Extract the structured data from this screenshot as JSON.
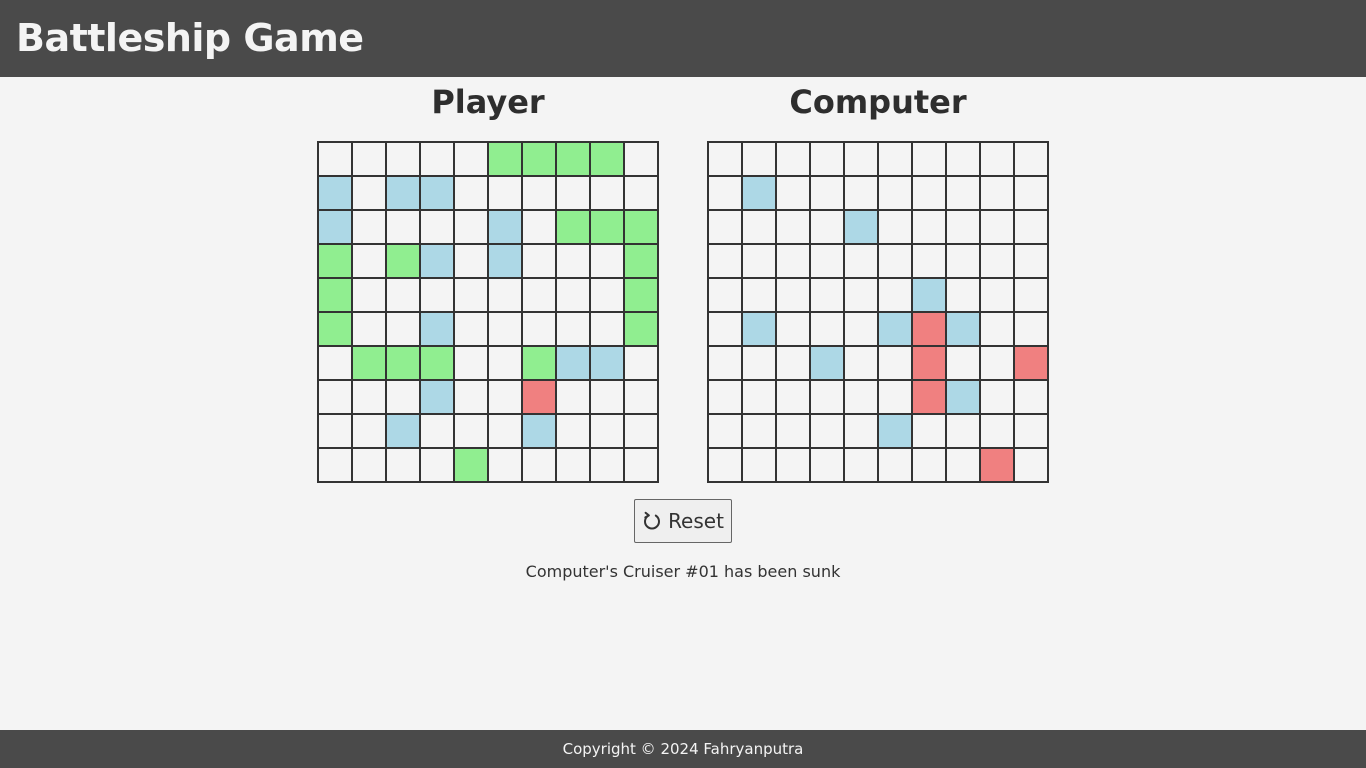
{
  "header": {
    "title": "Battleship Game"
  },
  "boards": [
    {
      "title": "Player",
      "rows": [
        ".....SSSS.",
        "M.MM......",
        "M....M.SSS",
        "S.SM.M...S",
        "S........S",
        "S..M.....S",
        ".SSS..SMM.",
        "...M..H...",
        "..M...M...",
        "....S....."
      ]
    },
    {
      "title": "Computer",
      "rows": [
        "..........",
        ".M........",
        "....M.....",
        "..........",
        "......M...",
        ".M...MHM..",
        "...M..H..H",
        "......HM..",
        ".....M....",
        "........H."
      ]
    }
  ],
  "cell_legend": {
    "S": "ship",
    "M": "miss",
    "H": "hit",
    ".": "empty"
  },
  "colors": {
    "ship": "#90ee90",
    "miss": "#add8e6",
    "hit": "#f08080",
    "header_bg": "#4a4a4a",
    "background": "#f4f4f4"
  },
  "controls": {
    "reset_label": "Reset",
    "reset_icon": "rotate-ccw-icon"
  },
  "status": {
    "message": "Computer's Cruiser #01 has been sunk"
  },
  "footer": {
    "text": "Copyright © 2024 Fahryanputra"
  }
}
